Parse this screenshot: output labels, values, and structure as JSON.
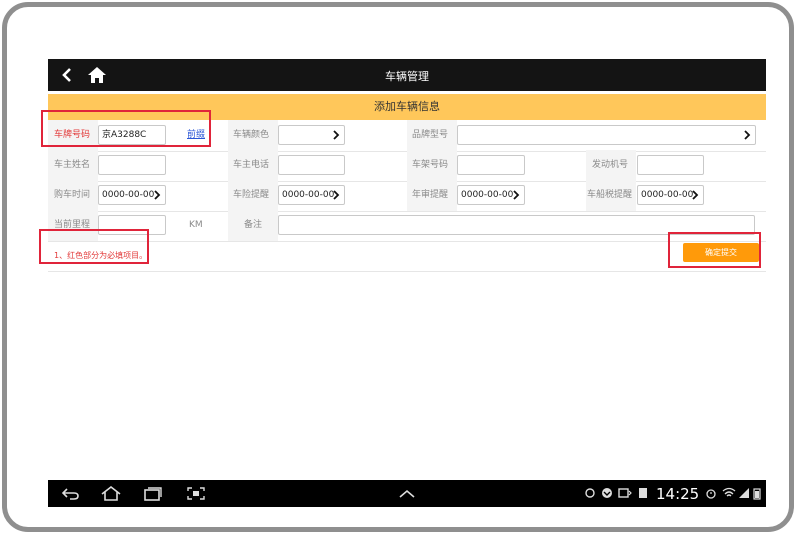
{
  "header": {
    "title": "车辆管理"
  },
  "subheader": {
    "title": "添加车辆信息"
  },
  "form": {
    "plate_label": "车牌号码",
    "plate_value": "京A3288C",
    "plate_link": "前缀",
    "color_label": "车辆颜色",
    "brand_label": "品牌型号",
    "owner_name_label": "车主姓名",
    "owner_phone_label": "车主电话",
    "vin_label": "车架号码",
    "engine_label": "发动机号",
    "purchase_label": "购车时间",
    "purchase_value": "0000-00-00",
    "insurance_label": "车险提醒",
    "insurance_value": "0000-00-00",
    "inspection_label": "年审提醒",
    "inspection_value": "0000-00-00",
    "tax_label": "车船税提醒",
    "tax_value": "0000-00-00",
    "mileage_label": "当前里程",
    "mileage_unit": "KM",
    "remark_label": "备注"
  },
  "note": "1、红色部分为必填项目。",
  "submit_label": "确定提交",
  "statusbar": {
    "time": "14:25"
  },
  "icons": [
    "back-arrow-icon",
    "home-icon",
    "chevron-right-icon",
    "nav-back-icon",
    "nav-home-icon",
    "nav-recent-icon",
    "screenshot-icon",
    "nav-up-icon",
    "wifi-icon",
    "battery-icon",
    "alarm-icon"
  ]
}
